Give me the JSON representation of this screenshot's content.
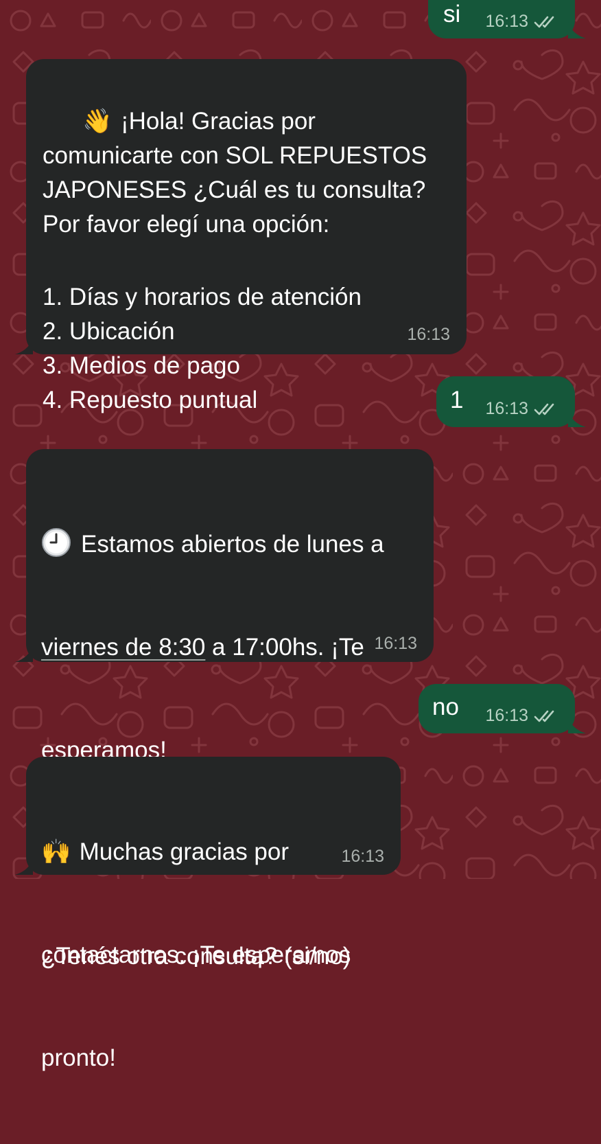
{
  "conversation": {
    "msg_out_si": {
      "text": "si",
      "time": "16:13",
      "status_icon": "double-check-icon"
    },
    "msg_in_welcome": {
      "emoji": "👋",
      "text": "¡Hola! Gracias por comunicarte con SOL REPUESTOS JAPONESES ¿Cuál es tu consulta? Por favor elegí una opción:",
      "options": [
        "1. Días y horarios de atención",
        "2. Ubicación",
        "3. Medios de pago",
        "4. Repuesto puntual"
      ],
      "time": "16:13"
    },
    "msg_out_1": {
      "text": "1",
      "time": "16:13",
      "status_icon": "double-check-icon"
    },
    "msg_in_hours": {
      "emoji_icon": "clock-emoji-icon",
      "line1": "Estamos abiertos de lunes a",
      "link_text": "viernes de 8:30",
      "line2_rest": " a 17:00hs. ¡Te",
      "line3": "esperamos!",
      "question": "¿Tenés otra consulta? (si/no)",
      "time": "16:13"
    },
    "msg_out_no": {
      "text": "no",
      "time": "16:13",
      "status_icon": "double-check-icon"
    },
    "msg_in_thanks": {
      "emoji": "🙌",
      "line1": "Muchas gracias por",
      "line2": "contactarnos. ¡Te esperamos",
      "line3": "pronto!",
      "time": "16:13"
    }
  },
  "colors": {
    "wallpaper": "#6a1e27",
    "incoming_bubble": "#242626",
    "outgoing_bubble": "#15573a",
    "message_text": "#ffffff",
    "timestamp": "#aab0ad"
  }
}
